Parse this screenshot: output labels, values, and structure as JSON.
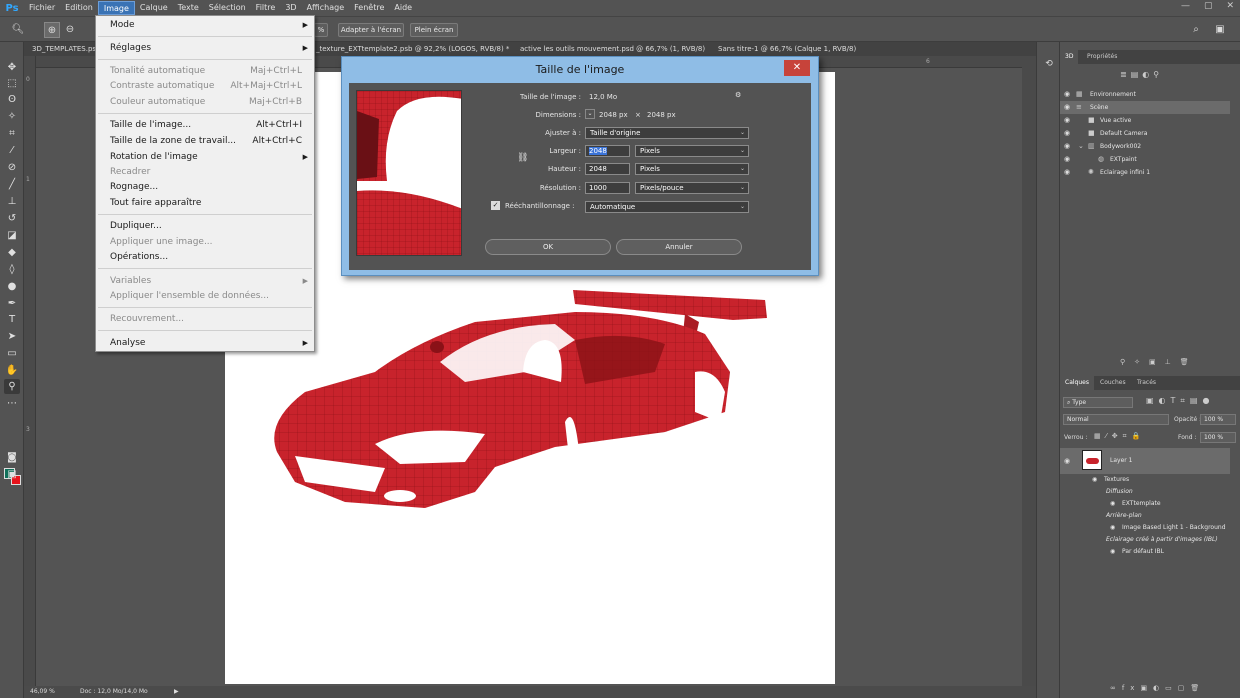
{
  "menubar": {
    "logo": "Ps",
    "items": [
      "Fichier",
      "Edition",
      "Image",
      "Calque",
      "Texte",
      "Sélection",
      "Filtre",
      "3D",
      "Affichage",
      "Fenêtre",
      "Aide"
    ]
  },
  "optionsbar": {
    "zoom_pct": "%",
    "fit_button": "Adapter à l'écran",
    "fullscreen_button": "Plein écran"
  },
  "tabs": [
    "3D_TEMPLATES.ps",
    "_texture_EXTtemplate2.psb @ 92,2% (LOGOS, RVB/8) *",
    "active les outils mouvement.psd @ 66,7% (1, RVB/8)",
    "Sans titre-1 @ 66,7% (Calque 1, RVB/8)"
  ],
  "image_menu": {
    "items": [
      {
        "label": "Mode",
        "shortcut": "",
        "submenu": true,
        "disabled": false
      },
      {
        "label": "Réglages",
        "shortcut": "",
        "submenu": true,
        "disabled": false
      },
      {
        "label": "Tonalité automatique",
        "shortcut": "Maj+Ctrl+L",
        "submenu": false,
        "disabled": true
      },
      {
        "label": "Contraste automatique",
        "shortcut": "Alt+Maj+Ctrl+L",
        "submenu": false,
        "disabled": true
      },
      {
        "label": "Couleur automatique",
        "shortcut": "Maj+Ctrl+B",
        "submenu": false,
        "disabled": true
      },
      {
        "label": "Taille de l'image...",
        "shortcut": "Alt+Ctrl+I",
        "submenu": false,
        "disabled": false
      },
      {
        "label": "Taille de la zone de travail...",
        "shortcut": "Alt+Ctrl+C",
        "submenu": false,
        "disabled": false
      },
      {
        "label": "Rotation de l'image",
        "shortcut": "",
        "submenu": true,
        "disabled": false
      },
      {
        "label": "Recadrer",
        "shortcut": "",
        "submenu": false,
        "disabled": true
      },
      {
        "label": "Rognage...",
        "shortcut": "",
        "submenu": false,
        "disabled": false
      },
      {
        "label": "Tout faire apparaître",
        "shortcut": "",
        "submenu": false,
        "disabled": false
      },
      {
        "label": "Dupliquer...",
        "shortcut": "",
        "submenu": false,
        "disabled": false
      },
      {
        "label": "Appliquer une image...",
        "shortcut": "",
        "submenu": false,
        "disabled": true
      },
      {
        "label": "Opérations...",
        "shortcut": "",
        "submenu": false,
        "disabled": false
      },
      {
        "label": "Variables",
        "shortcut": "",
        "submenu": true,
        "disabled": true
      },
      {
        "label": "Appliquer l'ensemble de données...",
        "shortcut": "",
        "submenu": false,
        "disabled": true
      },
      {
        "label": "Recouvrement...",
        "shortcut": "",
        "submenu": false,
        "disabled": true
      },
      {
        "label": "Analyse",
        "shortcut": "",
        "submenu": true,
        "disabled": false
      }
    ]
  },
  "dialog": {
    "title": "Taille de l'image",
    "close": "✕",
    "size_label": "Taille de l'image :",
    "size_value": "12,0 Mo",
    "dimensions_label": "Dimensions :",
    "dimensions_w": "2048 px",
    "dimensions_x": "×",
    "dimensions_h": "2048 px",
    "fit_label": "Ajuster à :",
    "fit_value": "Taille d'origine",
    "width_label": "Largeur :",
    "width_value": "2048",
    "width_unit": "Pixels",
    "height_label": "Hauteur :",
    "height_value": "2048",
    "height_unit": "Pixels",
    "resolution_label": "Résolution :",
    "resolution_value": "1000",
    "resolution_unit": "Pixels/pouce",
    "resample_label": "Rééchantillonnage :",
    "resample_value": "Automatique",
    "ok": "OK",
    "cancel": "Annuler"
  },
  "panel3d": {
    "tabs": [
      "3D",
      "Propriétés"
    ],
    "rows": [
      {
        "label": "Environnement",
        "indent": 0,
        "selected": false
      },
      {
        "label": "Scène",
        "indent": 0,
        "selected": true
      },
      {
        "label": "Vue active",
        "indent": 1,
        "selected": false
      },
      {
        "label": "Default Camera",
        "indent": 1,
        "selected": false
      },
      {
        "label": "Bodywork002",
        "indent": 1,
        "selected": false
      },
      {
        "label": "EXTpaint",
        "indent": 2,
        "selected": false
      },
      {
        "label": "Eclairage infini 1",
        "indent": 1,
        "selected": false
      }
    ]
  },
  "layers": {
    "tabs": [
      "Calques",
      "Couches",
      "Tracés"
    ],
    "filter": "Type",
    "blend": "Normal",
    "opacity_label": "Opacité :",
    "opacity": "100 %",
    "lock_label": "Verrou :",
    "fill_label": "Fond :",
    "fill": "100 %",
    "layer_name": "Layer 1",
    "textures": "Textures",
    "diffusion": "Diffusion",
    "ext_template": "EXTtemplate",
    "background": "Arrière-plan",
    "ibl": "Image Based Light 1 - Background",
    "ibl_section": "Eclairage créé à partir d'images (IBL)",
    "default_ibl": "Par défaut IBL"
  },
  "status": {
    "zoom": "46,09 %",
    "doc": "Doc : 12,0 Mo/14,0 Mo"
  },
  "colors": {
    "foreground": "#11705a",
    "background": "#e8141c",
    "car": "#c8232c"
  }
}
